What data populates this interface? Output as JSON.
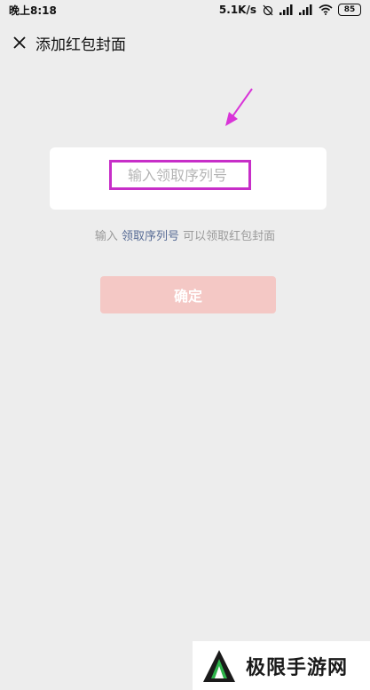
{
  "status_bar": {
    "time": "晚上8:18",
    "network_speed": "5.1K/s",
    "battery": "85"
  },
  "header": {
    "close_icon": "close-icon",
    "title": "添加红包封面"
  },
  "form": {
    "serial_placeholder": "输入领取序列号",
    "serial_value": ""
  },
  "hint": {
    "prefix": "输入",
    "link": "领取序列号",
    "suffix": "可以领取红包封面"
  },
  "confirm_label": "确定",
  "watermark": {
    "text": "极限手游网"
  },
  "colors": {
    "background": "#ededed",
    "highlight_box": "#c72ec8",
    "arrow": "#d934d8",
    "button_disabled": "#f4c8c5",
    "link": "#576b95"
  }
}
